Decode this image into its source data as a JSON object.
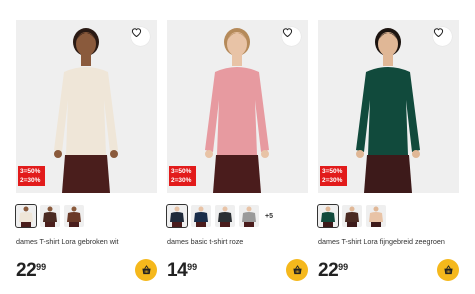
{
  "products": [
    {
      "title": "dames T-shirt Lora gebroken wit",
      "price_int": "22",
      "price_dec": "99",
      "promo": [
        "3=50%",
        "2=30%"
      ],
      "extra_colors": "",
      "shirt_color": "#efe6d8",
      "bottom_color": "#4a1e1c",
      "skin_color": "#8a5a3c",
      "hair_color": "#2a1a14",
      "swatches": [
        "#efe6d8",
        "#4a2a22",
        "#6b3a28"
      ]
    },
    {
      "title": "dames basic t-shirt roze",
      "price_int": "14",
      "price_dec": "99",
      "promo": [
        "3=50%",
        "2=30%"
      ],
      "extra_colors": "+5",
      "shirt_color": "#e79aa0",
      "bottom_color": "#4a1c1c",
      "skin_color": "#e8c3a6",
      "hair_color": "#b58a5a",
      "swatches": [
        "#1f2a3a",
        "#1a2d4a",
        "#2b2f33",
        "#9a9a9a"
      ]
    },
    {
      "title": "dames T-shirt Lora fijngebreid zeegroen",
      "price_int": "22",
      "price_dec": "99",
      "promo": [
        "3=50%",
        "2=30%"
      ],
      "extra_colors": "",
      "shirt_color": "#114a3c",
      "bottom_color": "#3d1a1a",
      "skin_color": "#e0b796",
      "hair_color": "#1c1410",
      "swatches": [
        "#114a3c",
        "#4a2a22",
        "#e8c3a6"
      ]
    }
  ],
  "icons": {
    "favorite": "heart-outline-icon",
    "cart": "shopping-basket-icon"
  },
  "colors": {
    "promo_bg": "#e21b1b",
    "cart_bg": "#f5b81c",
    "photo_bg": "#efefef"
  }
}
